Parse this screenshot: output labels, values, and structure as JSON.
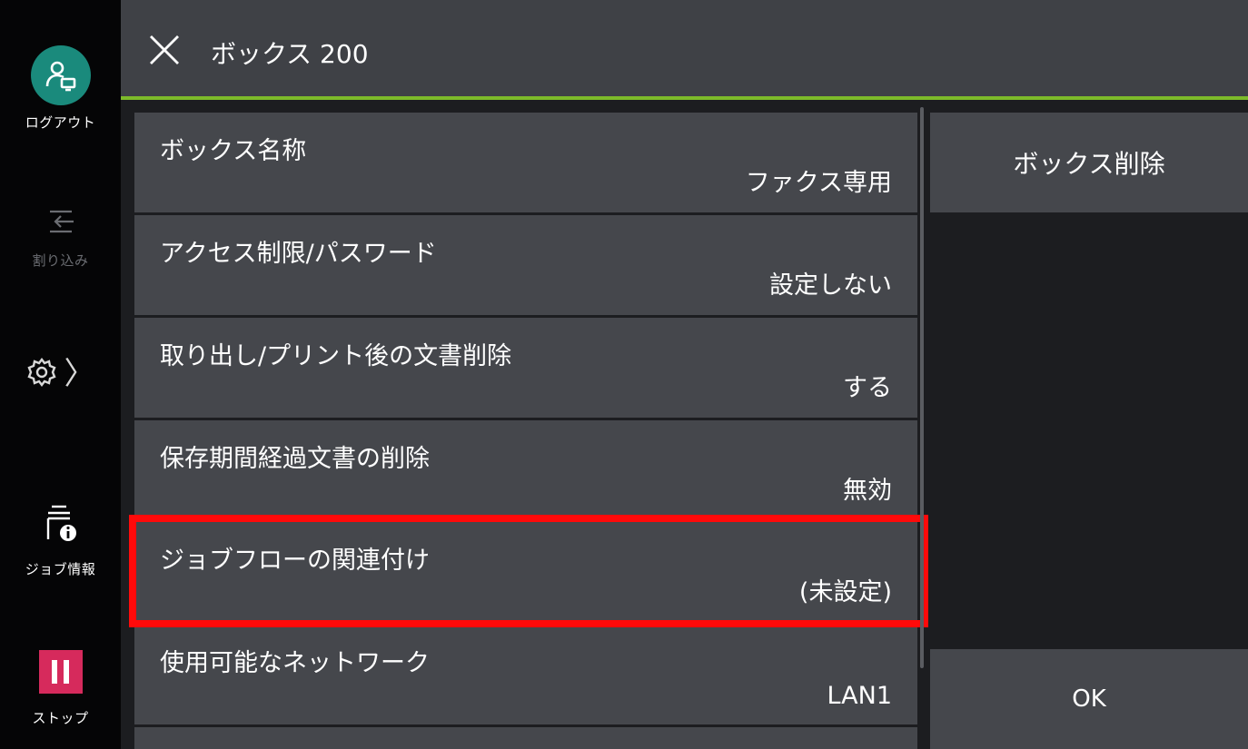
{
  "sidebar": {
    "logout_label": "ログアウト",
    "interrupt_label": "割り込み",
    "jobinfo_label": "ジョブ情報",
    "stop_label": "ストップ"
  },
  "header": {
    "title": "ボックス 200"
  },
  "rows": [
    {
      "label": "ボックス名称",
      "value": "ファクス専用"
    },
    {
      "label": "アクセス制限/パスワード",
      "value": "設定しない"
    },
    {
      "label": "取り出し/プリント後の文書削除",
      "value": "する"
    },
    {
      "label": "保存期間経過文書の削除",
      "value": "無効"
    },
    {
      "label": "ジョブフローの関連付け",
      "value": "(未設定)"
    },
    {
      "label": "使用可能なネットワーク",
      "value": "LAN1"
    }
  ],
  "actions": {
    "delete_label": "ボックス削除",
    "ok_label": "OK"
  },
  "colors": {
    "accent_green": "#7dbb2a",
    "logout_teal": "#1a8a7c",
    "stop_pink": "#d62a5c",
    "highlight_red": "#ff0a0a"
  }
}
